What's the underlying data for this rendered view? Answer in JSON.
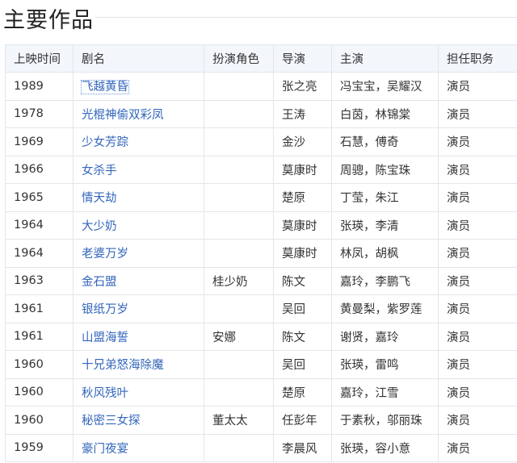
{
  "section_title": "主要作品",
  "table": {
    "headers": [
      "上映时间",
      "剧名",
      "扮演角色",
      "导演",
      "主演",
      "担任职务"
    ],
    "rows": [
      {
        "year": "1989",
        "title": "飞越黄昏",
        "role": "",
        "director": "张之亮",
        "stars": "冯宝宝，吴耀汉",
        "job": "演员"
      },
      {
        "year": "1978",
        "title": "光棍神偷双彩凤",
        "role": "",
        "director": "王涛",
        "stars": "白茵，林锦棠",
        "job": "演员"
      },
      {
        "year": "1969",
        "title": "少女芳踪",
        "role": "",
        "director": "金沙",
        "stars": "石慧，傅奇",
        "job": "演员"
      },
      {
        "year": "1966",
        "title": "女杀手",
        "role": "",
        "director": "莫康时",
        "stars": "周骢，陈宝珠",
        "job": "演员"
      },
      {
        "year": "1965",
        "title": "情天劫",
        "role": "",
        "director": "楚原",
        "stars": "丁莹，朱江",
        "job": "演员"
      },
      {
        "year": "1964",
        "title": "大少奶",
        "role": "",
        "director": "莫康时",
        "stars": "张瑛，李清",
        "job": "演员"
      },
      {
        "year": "1964",
        "title": "老婆万岁",
        "role": "",
        "director": "莫康时",
        "stars": "林凤，胡枫",
        "job": "演员"
      },
      {
        "year": "1963",
        "title": "金石盟",
        "role": "桂少奶",
        "director": "陈文",
        "stars": "嘉玲，李鹏飞",
        "job": "演员"
      },
      {
        "year": "1961",
        "title": "银纸万岁",
        "role": "",
        "director": "吴回",
        "stars": "黄曼梨，紫罗莲",
        "job": "演员"
      },
      {
        "year": "1961",
        "title": "山盟海誓",
        "role": "安娜",
        "director": "陈文",
        "stars": "谢贤，嘉玲",
        "job": "演员"
      },
      {
        "year": "1960",
        "title": "十兄弟怒海除魔",
        "role": "",
        "director": "吴回",
        "stars": "张瑛，雷鸣",
        "job": "演员"
      },
      {
        "year": "1960",
        "title": "秋风残叶",
        "role": "",
        "director": "楚原",
        "stars": "嘉玲，江雪",
        "job": "演员"
      },
      {
        "year": "1960",
        "title": "秘密三女探",
        "role": "董太太",
        "director": "任彭年",
        "stars": "于素秋，邬丽珠",
        "job": "演员"
      },
      {
        "year": "1959",
        "title": "豪门夜宴",
        "role": "",
        "director": "李晨风",
        "stars": "张瑛，容小意",
        "job": "演员"
      }
    ]
  }
}
